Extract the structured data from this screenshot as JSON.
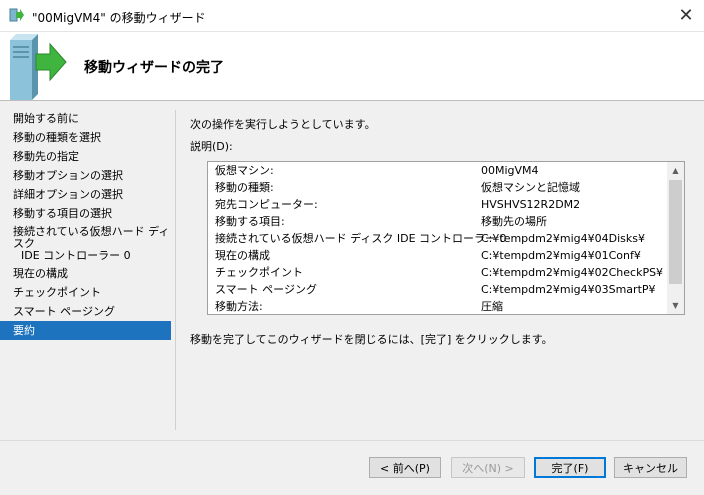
{
  "window": {
    "title": "\"00MigVM4\" の移動ウィザード",
    "close_glyph": "✕"
  },
  "header": {
    "title": "移動ウィザードの完了"
  },
  "nav": {
    "items": [
      {
        "label": "開始する前に"
      },
      {
        "label": "移動の種類を選択"
      },
      {
        "label": "移動先の指定"
      },
      {
        "label": "移動オプションの選択"
      },
      {
        "label": "詳細オプションの選択"
      },
      {
        "label": "移動する項目の選択"
      },
      {
        "label": "接続されている仮想ハード ディスク",
        "sub": "IDE コントローラー 0"
      },
      {
        "label": "現在の構成"
      },
      {
        "label": "チェックポイント"
      },
      {
        "label": "スマート ページング"
      },
      {
        "label": "要約",
        "selected": true
      }
    ]
  },
  "main": {
    "intro": "次の操作を実行しようとしています。",
    "description_label": "説明(D):",
    "summary": [
      {
        "key": "仮想マシン:",
        "value": "00MigVM4"
      },
      {
        "key": "移動の種類:",
        "value": "仮想マシンと記憶域"
      },
      {
        "key": "宛先コンピューター:",
        "value": "HVSHVS12R2DM2"
      },
      {
        "key": "移動する項目:",
        "value": "移動先の場所"
      },
      {
        "key": "接続されている仮想ハード ディスク IDE コントローラー 0",
        "value": "C:¥tempdm2¥mig4¥04Disks¥"
      },
      {
        "key": "現在の構成",
        "value": "C:¥tempdm2¥mig4¥01Conf¥"
      },
      {
        "key": "チェックポイント",
        "value": "C:¥tempdm2¥mig4¥02CheckPS¥"
      },
      {
        "key": "スマート ページング",
        "value": "C:¥tempdm2¥mig4¥03SmartP¥"
      },
      {
        "key": "移動方法:",
        "value": "圧縮"
      }
    ],
    "finish_note": "移動を完了してこのウィザードを閉じるには、[完了] をクリックします。"
  },
  "buttons": {
    "back": "< 前へ(P)",
    "next": "次へ(N) >",
    "finish": "完了(F)",
    "cancel": "キャンセル"
  },
  "colors": {
    "selection": "#1e73be",
    "arrow": "#3fb43f",
    "server": "#7fb6cf"
  }
}
